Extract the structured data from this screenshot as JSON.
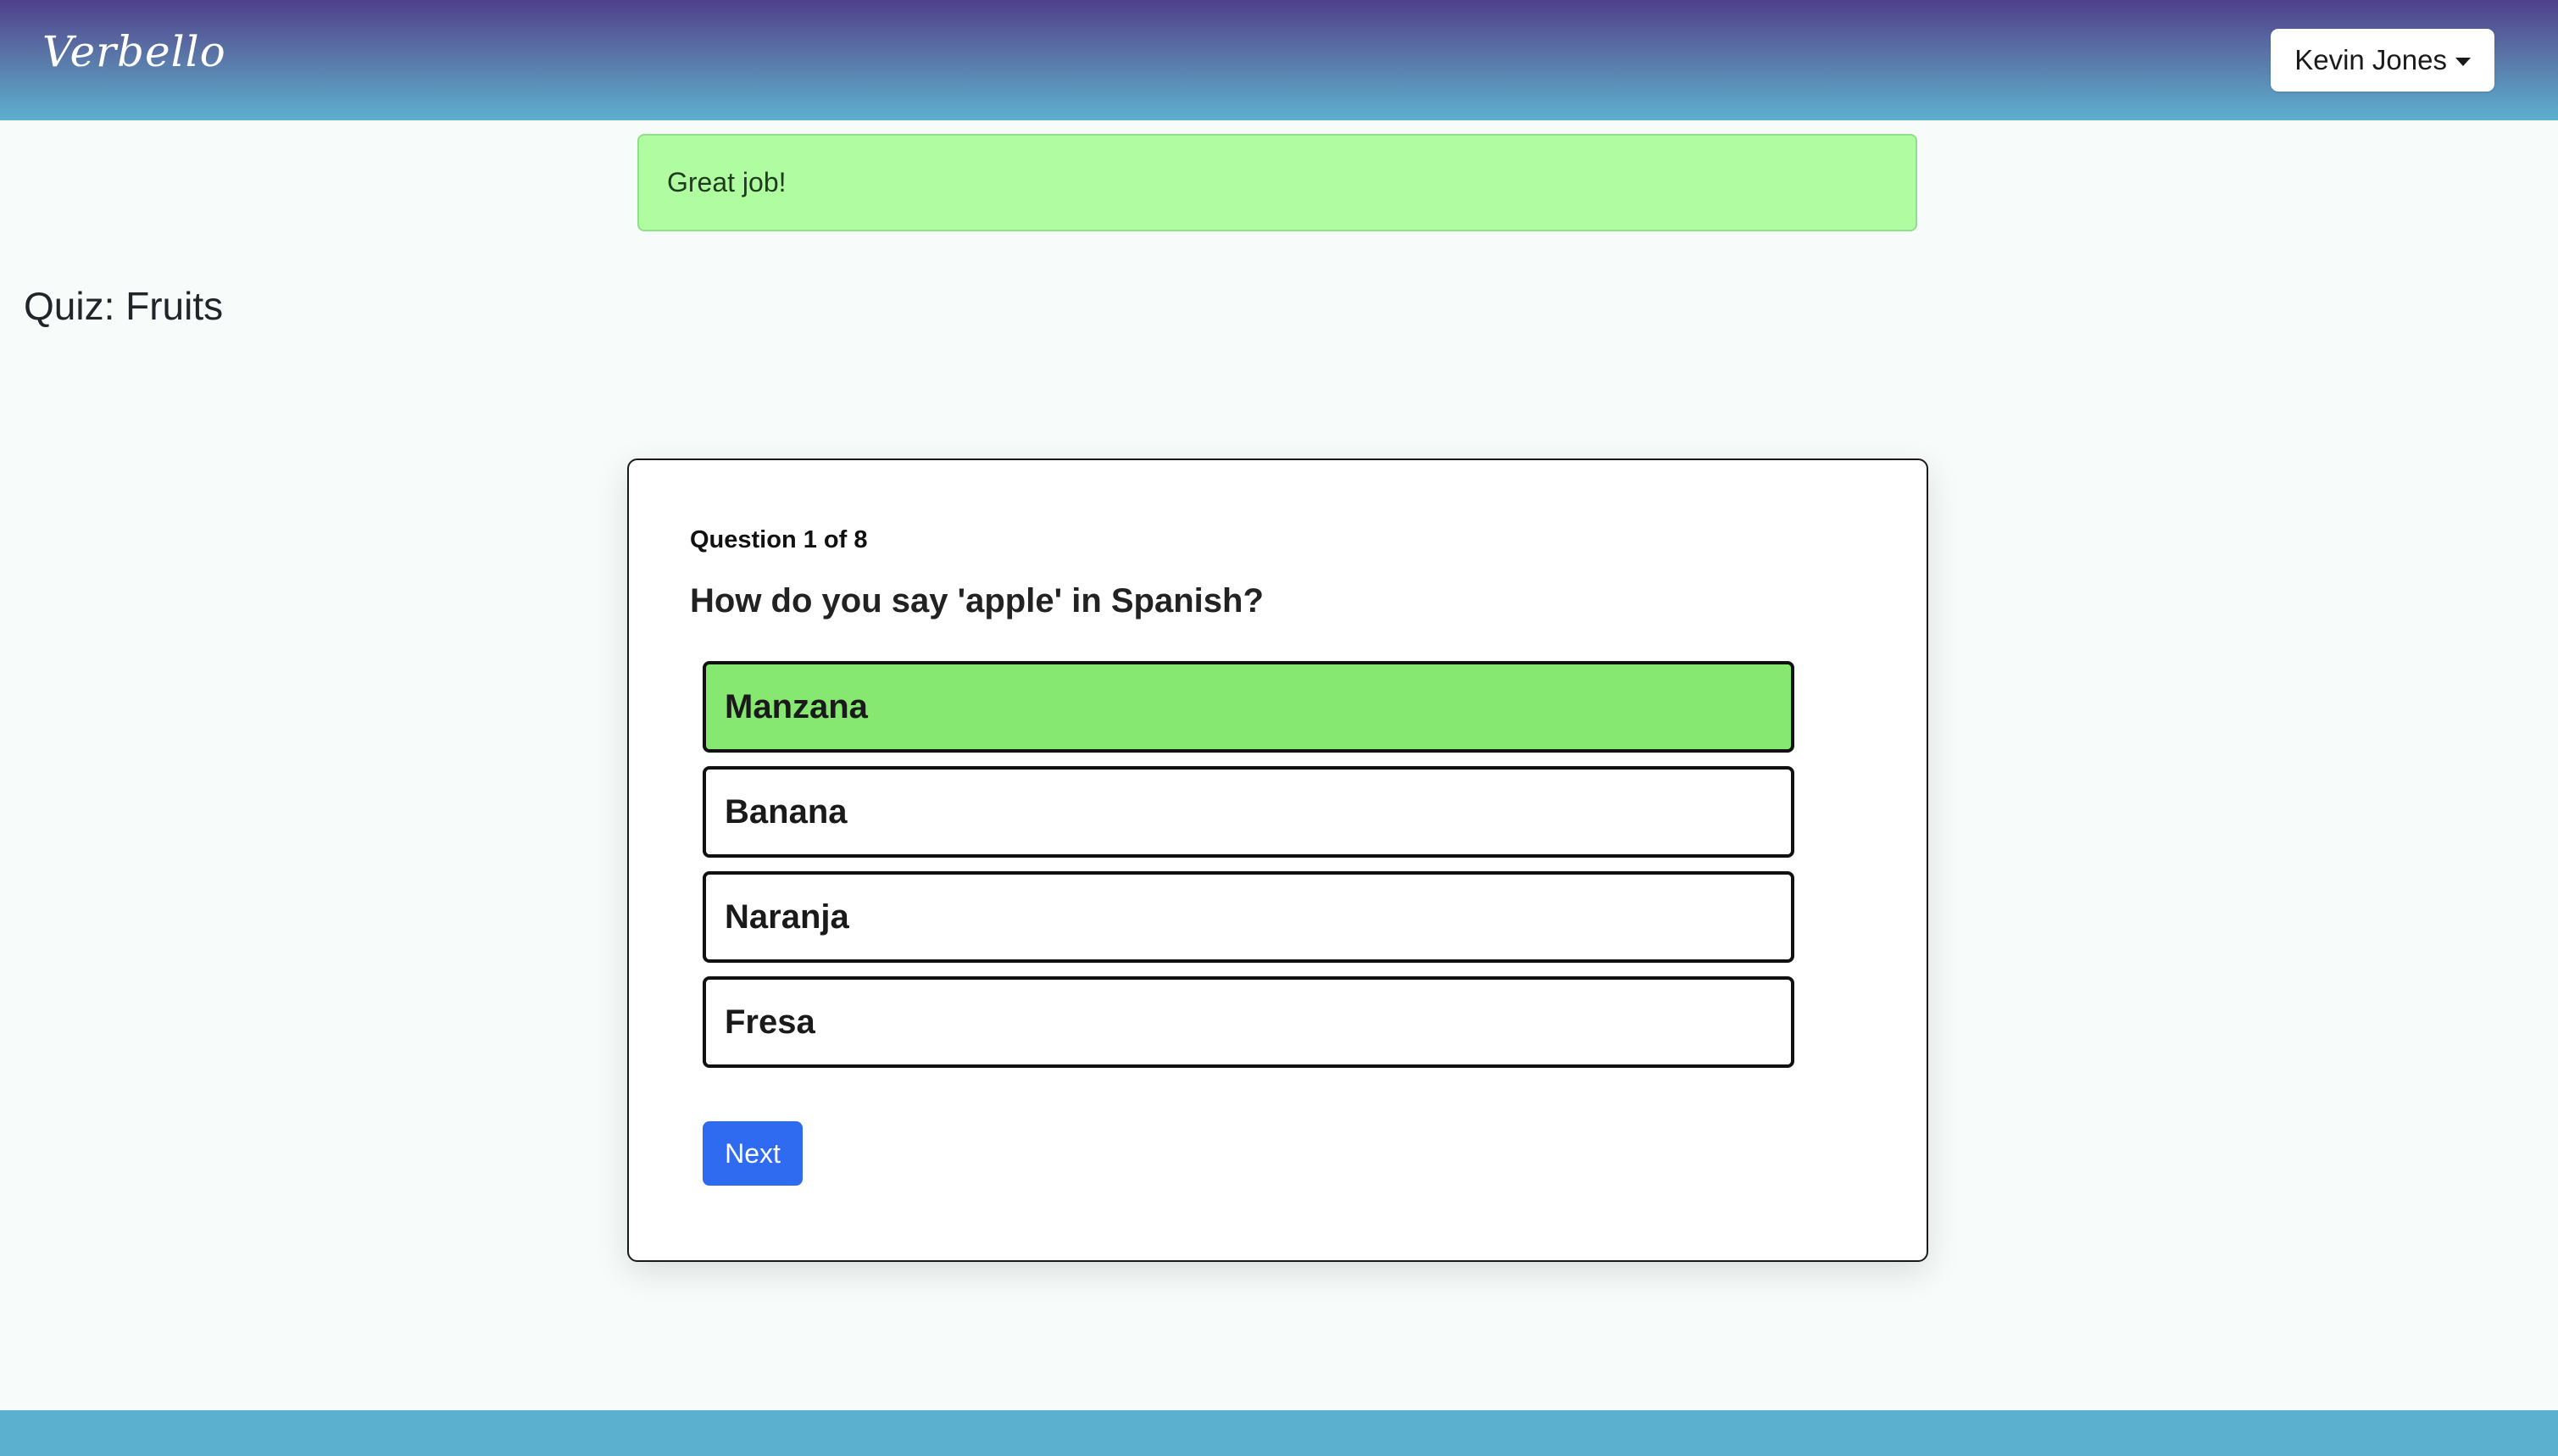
{
  "navbar": {
    "brand": "Verbello",
    "user_name": "Kevin Jones"
  },
  "alert": {
    "message": "Great job!"
  },
  "quiz": {
    "title": "Quiz: Fruits",
    "counter": "Question 1 of 8",
    "question": "How do you say 'apple' in Spanish?",
    "options": [
      {
        "label": "Manzana",
        "state": "correct"
      },
      {
        "label": "Banana",
        "state": "default"
      },
      {
        "label": "Naranja",
        "state": "default"
      },
      {
        "label": "Fresa",
        "state": "default"
      }
    ],
    "next_label": "Next"
  },
  "colors": {
    "correct_option": "#86e870",
    "alert_bg": "#b0fca1",
    "primary_button": "#2e6bf0"
  }
}
